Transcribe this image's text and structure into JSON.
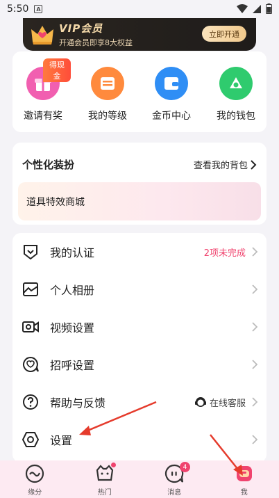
{
  "status_bar": {
    "time": "5:50",
    "notif_letter": "A"
  },
  "vip": {
    "title": "VIP会员",
    "subtitle": "开通会员即享8大权益",
    "button": "立即开通"
  },
  "quick_actions": [
    {
      "label": "邀请有奖",
      "badge": "得现金",
      "icon": "gift-icon",
      "color": "#f15fb0"
    },
    {
      "label": "我的等级",
      "icon": "level-icon",
      "color": "#ff8a3d"
    },
    {
      "label": "金币中心",
      "icon": "wallet-icon",
      "color": "#2f8ef5"
    },
    {
      "label": "我的钱包",
      "icon": "money-icon",
      "color": "#2fcb6e"
    }
  ],
  "decoration": {
    "title": "个性化装扮",
    "link": "查看我的背包",
    "banner": "道具特效商城"
  },
  "menu": [
    {
      "label": "我的认证",
      "right": "2项未完成",
      "icon": "certify-icon"
    },
    {
      "label": "个人相册",
      "icon": "album-icon"
    },
    {
      "label": "视频设置",
      "icon": "video-icon"
    },
    {
      "label": "招呼设置",
      "icon": "greet-icon"
    },
    {
      "label": "帮助与反馈",
      "right": "在线客服",
      "icon": "help-icon"
    },
    {
      "label": "设置",
      "icon": "settings-icon"
    }
  ],
  "tabs": [
    {
      "label": "缘分",
      "icon": "fate-icon"
    },
    {
      "label": "热门",
      "icon": "hot-icon"
    },
    {
      "label": "消息",
      "icon": "message-icon",
      "badge": "4"
    },
    {
      "label": "我",
      "icon": "me-icon"
    }
  ],
  "colors": {
    "accent": "#f0436e",
    "annotation": "#e53b2c"
  }
}
